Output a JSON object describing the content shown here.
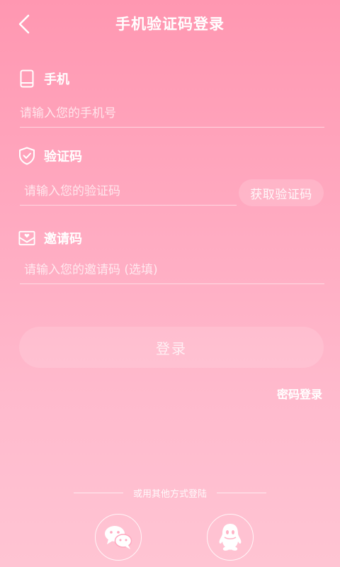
{
  "header": {
    "title": "手机验证码登录"
  },
  "phone": {
    "label": "手机",
    "placeholder": "请输入您的手机号",
    "value": ""
  },
  "code": {
    "label": "验证码",
    "placeholder": "请输入您的验证码",
    "value": "",
    "get_code_label": "获取验证码"
  },
  "invite": {
    "label": "邀请码",
    "placeholder": "请输入您的邀请码 (选填)",
    "value": ""
  },
  "login": {
    "button_label": "登录",
    "password_login_label": "密码登录"
  },
  "other_login": {
    "label": "或用其他方式登陆",
    "options": [
      "wechat-icon",
      "qq-icon"
    ]
  },
  "colors": {
    "background_top": "#ff97b1",
    "background_bottom": "#ffc4d3",
    "foreground": "#ffffff"
  }
}
